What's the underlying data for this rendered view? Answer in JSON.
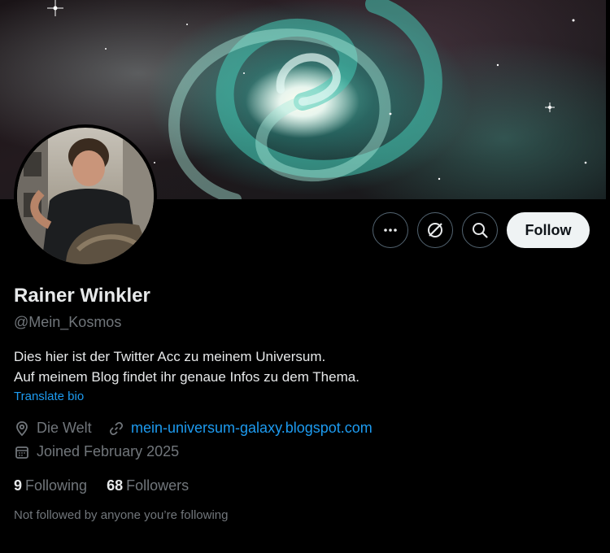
{
  "profile": {
    "display_name": "Rainer Winkler",
    "handle": "@Mein_Kosmos",
    "bio_line1": "Dies hier ist der Twitter Acc zu meinem Universum.",
    "bio_line2": "Auf meinem Blog findet ihr genaue Infos zu dem Thema.",
    "translate_label": "Translate bio",
    "location": "Die Welt",
    "website": "mein-universum-galaxy.blogspot.com",
    "joined": "Joined February 2025",
    "following_count": "9",
    "following_label": "Following",
    "followers_count": "68",
    "followers_label": "Followers",
    "not_followed_text": "Not followed by anyone you’re following"
  },
  "actions": {
    "follow_label": "Follow",
    "more_icon": "more-icon",
    "grok_icon": "grok-icon",
    "search_icon": "search-icon"
  },
  "colors": {
    "background": "#000000",
    "text_primary": "#e7e9ea",
    "text_secondary": "#71767b",
    "accent": "#1d9bf0",
    "button_border": "#536471",
    "follow_bg": "#eff3f4"
  }
}
